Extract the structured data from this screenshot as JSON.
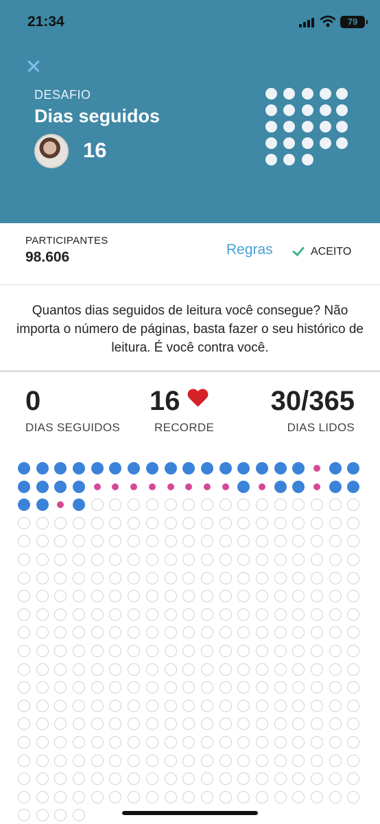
{
  "status": {
    "time": "21:34",
    "battery": "79"
  },
  "header": {
    "close_icon": "close-icon",
    "label": "DESAFIO",
    "title": "Dias seguidos",
    "avatar_count": "16",
    "background": "#3f88a6"
  },
  "participants": {
    "label": "PARTICIPANTES",
    "value": "98.606",
    "rules_label": "Regras",
    "accepted_label": "ACEITO"
  },
  "description": "Quantos dias seguidos de leitura você consegue? Não importa o número de páginas, basta fazer o seu histórico de leitura. É você contra você.",
  "stats": {
    "current": {
      "value": "0",
      "label": "DIAS SEGUIDOS"
    },
    "record": {
      "value": "16",
      "label": "RECORDE"
    },
    "total": {
      "value": "30/365",
      "label": "DIAS LIDOS"
    }
  },
  "calendar": {
    "total_days": 365,
    "status": [
      "read",
      "read",
      "read",
      "read",
      "read",
      "read",
      "read",
      "read",
      "read",
      "read",
      "read",
      "read",
      "read",
      "read",
      "read",
      "read",
      "missed",
      "read",
      "read",
      "read",
      "read",
      "read",
      "read",
      "missed",
      "missed",
      "missed",
      "missed",
      "missed",
      "missed",
      "missed",
      "missed",
      "read",
      "missed",
      "read",
      "read",
      "missed",
      "read",
      "read",
      "read",
      "read",
      "missed",
      "read"
    ],
    "colors": {
      "read": "#3b82d9",
      "missed": "#d44a96",
      "future": "#d2d2d2"
    }
  }
}
